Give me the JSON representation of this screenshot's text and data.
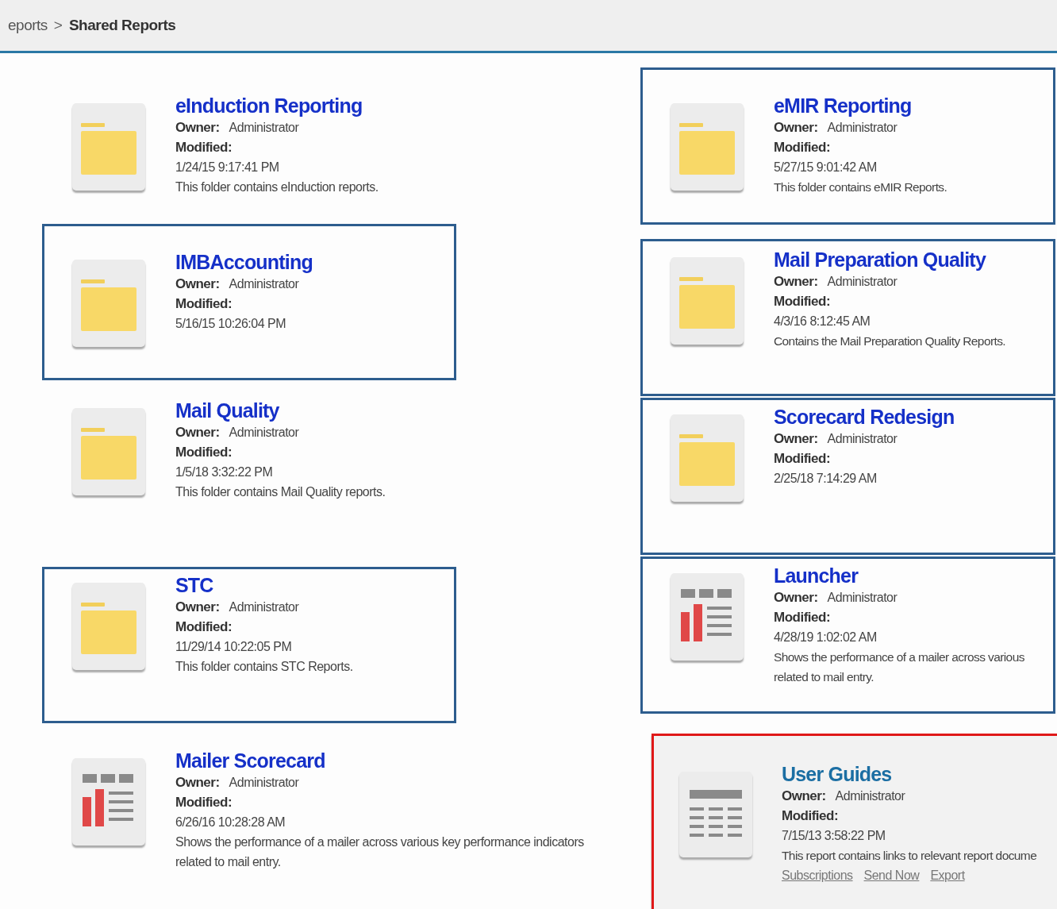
{
  "breadcrumb": [
    {
      "label": "eports",
      "current": false
    },
    {
      "label": "Shared Reports",
      "current": true
    }
  ],
  "breadcrumb_separator": ">",
  "columns": [
    {
      "items": [
        {
          "kind": "folder",
          "highlighted": false,
          "selected": false,
          "title": "eInduction Reporting",
          "owner_label": "Owner:",
          "owner": "Administrator",
          "modified_label": "Modified:",
          "modified": "1/24/15 9:17:41 PM",
          "description_lines": [
            "This folder contains eInduction reports."
          ]
        },
        {
          "kind": "folder",
          "highlighted": true,
          "color": "#2d5d8e",
          "selected": false,
          "title": "IMBAccounting",
          "owner_label": "Owner:",
          "owner": "Administrator",
          "modified_label": "Modified:",
          "modified": "5/16/15 10:26:04 PM"
        },
        {
          "kind": "folder",
          "highlighted": false,
          "selected": false,
          "title": "Mail Quality",
          "owner_label": "Owner:",
          "owner": "Administrator",
          "modified_label": "Modified:",
          "modified": "1/5/18 3:32:22 PM",
          "description_lines": [
            "This folder contains Mail Quality reports."
          ]
        },
        {
          "kind": "folder",
          "highlighted": true,
          "color": "#2d5d8e",
          "selected": false,
          "title": "STC",
          "owner_label": "Owner:",
          "owner": "Administrator",
          "modified_label": "Modified:",
          "modified": "11/29/14 10:22:05 PM",
          "description_lines": [
            "This folder contains STC Reports."
          ]
        },
        {
          "kind": "report",
          "highlighted": false,
          "selected": false,
          "title": "Mailer Scorecard",
          "owner_label": "Owner:",
          "owner": "Administrator",
          "modified_label": "Modified:",
          "modified": "6/26/16 10:28:28 AM",
          "description_lines": [
            "Shows the performance of a mailer across various key performance indicators",
            "related to mail entry."
          ]
        }
      ]
    },
    {
      "items": [
        {
          "kind": "folder",
          "highlighted": true,
          "color": "#2d5d8e",
          "selected": false,
          "title": "eMIR Reporting",
          "owner_label": "Owner:",
          "owner": "Administrator",
          "modified_label": "Modified:",
          "modified": "5/27/15 9:01:42 AM",
          "description_lines": [
            "This folder contains eMIR Reports."
          ]
        },
        {
          "kind": "folder",
          "highlighted": true,
          "color": "#2d5d8e",
          "selected": false,
          "title": "Mail Preparation Quality",
          "owner_label": "Owner:",
          "owner": "Administrator",
          "modified_label": "Modified:",
          "modified": "4/3/16 8:12:45 AM",
          "description_lines": [
            "Contains the Mail Preparation Quality Reports."
          ]
        },
        {
          "kind": "folder",
          "highlighted": true,
          "color": "#2d5d8e",
          "selected": false,
          "title": "Scorecard Redesign",
          "owner_label": "Owner:",
          "owner": "Administrator",
          "modified_label": "Modified:",
          "modified": "2/25/18 7:14:29 AM"
        },
        {
          "kind": "report",
          "highlighted": true,
          "color": "#2d5d8e",
          "selected": false,
          "title": "Launcher",
          "owner_label": "Owner:",
          "owner": "Administrator",
          "modified_label": "Modified:",
          "modified": "4/28/19 1:02:02 AM",
          "description_lines": [
            "Shows the performance of a mailer across various",
            "related to mail entry."
          ]
        },
        {
          "kind": "guide",
          "highlighted": true,
          "color": "#e01818",
          "selected": true,
          "title": "User Guides",
          "owner_label": "Owner:",
          "owner": "Administrator",
          "modified_label": "Modified:",
          "modified": "7/15/13 3:58:22 PM",
          "description_lines": [
            "This report contains links to relevant report docume"
          ],
          "links": [
            "Subscriptions",
            "Send Now",
            "Export"
          ]
        }
      ]
    }
  ]
}
